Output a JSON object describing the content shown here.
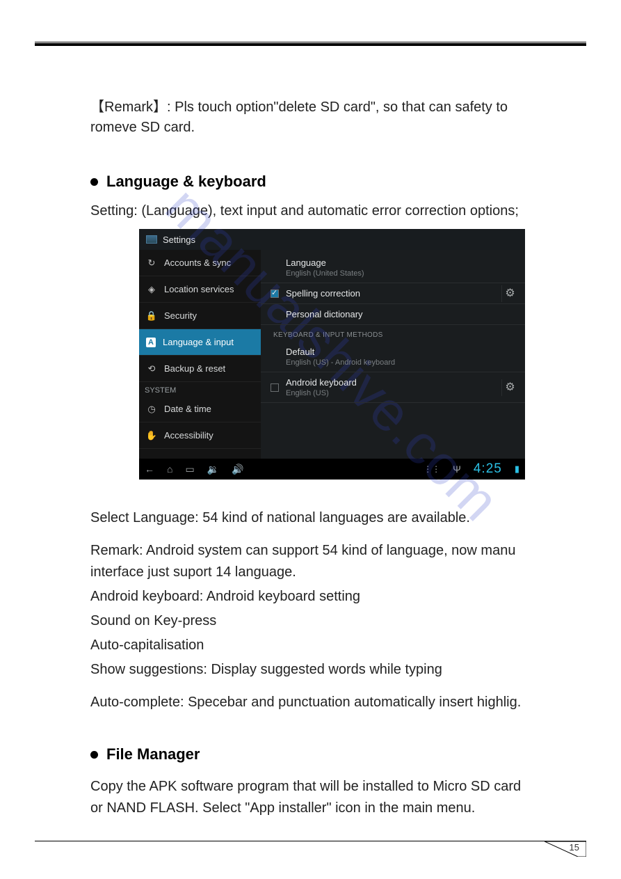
{
  "remark": "【Remark】: Pls touch option\"delete SD card\", so that can safety to romeve SD card.",
  "section1": {
    "title": "Language & keyboard",
    "intro": "Setting: (Language), text input and automatic error correction options;"
  },
  "screenshot": {
    "title": "Settings",
    "sidebar": [
      {
        "icon": "↻",
        "label": "Accounts & sync",
        "sel": false
      },
      {
        "icon": "◈",
        "label": "Location services",
        "sel": false
      },
      {
        "icon": "🔒",
        "label": "Security",
        "sel": false
      },
      {
        "icon": "A",
        "label": "Language & input",
        "sel": true
      },
      {
        "icon": "⟲",
        "label": "Backup & reset",
        "sel": false
      }
    ],
    "sidebar_cat": "SYSTEM",
    "sidebar2": [
      {
        "icon": "◷",
        "label": "Date & time"
      },
      {
        "icon": "✋",
        "label": "Accessibility"
      }
    ],
    "rows": [
      {
        "t1": "Language",
        "t2": "English (United States)"
      }
    ],
    "row_spell": {
      "t1": "Spelling correction"
    },
    "row_dict": {
      "t1": "Personal dictionary"
    },
    "cat": "KEYBOARD & INPUT METHODS",
    "row_def": {
      "t1": "Default",
      "t2": "English (US) - Android keyboard"
    },
    "row_kb": {
      "t1": "Android keyboard",
      "t2": "English (US)"
    },
    "clock": "4:25"
  },
  "body": {
    "l1": "Select Language: 54 kind of national languages are available.",
    "l2": "Remark: Android system can support 54 kind of language, now manu interface just suport  14 language.",
    "l3": "Android keyboard: Android keyboard setting",
    "l4": "Sound on Key-press",
    "l5": "Auto-capitalisation",
    "l6": "Show suggestions: Display suggested words while typing",
    "l7": "Auto-complete: Specebar and punctuation automatically insert highlig."
  },
  "section2": {
    "title": "File Manager",
    "text": "Copy the APK software program that will be installed to Micro SD card or NAND FLASH. Select \"App installer\" icon in the main menu."
  },
  "watermark": "manualshive.com",
  "page_number": "15"
}
